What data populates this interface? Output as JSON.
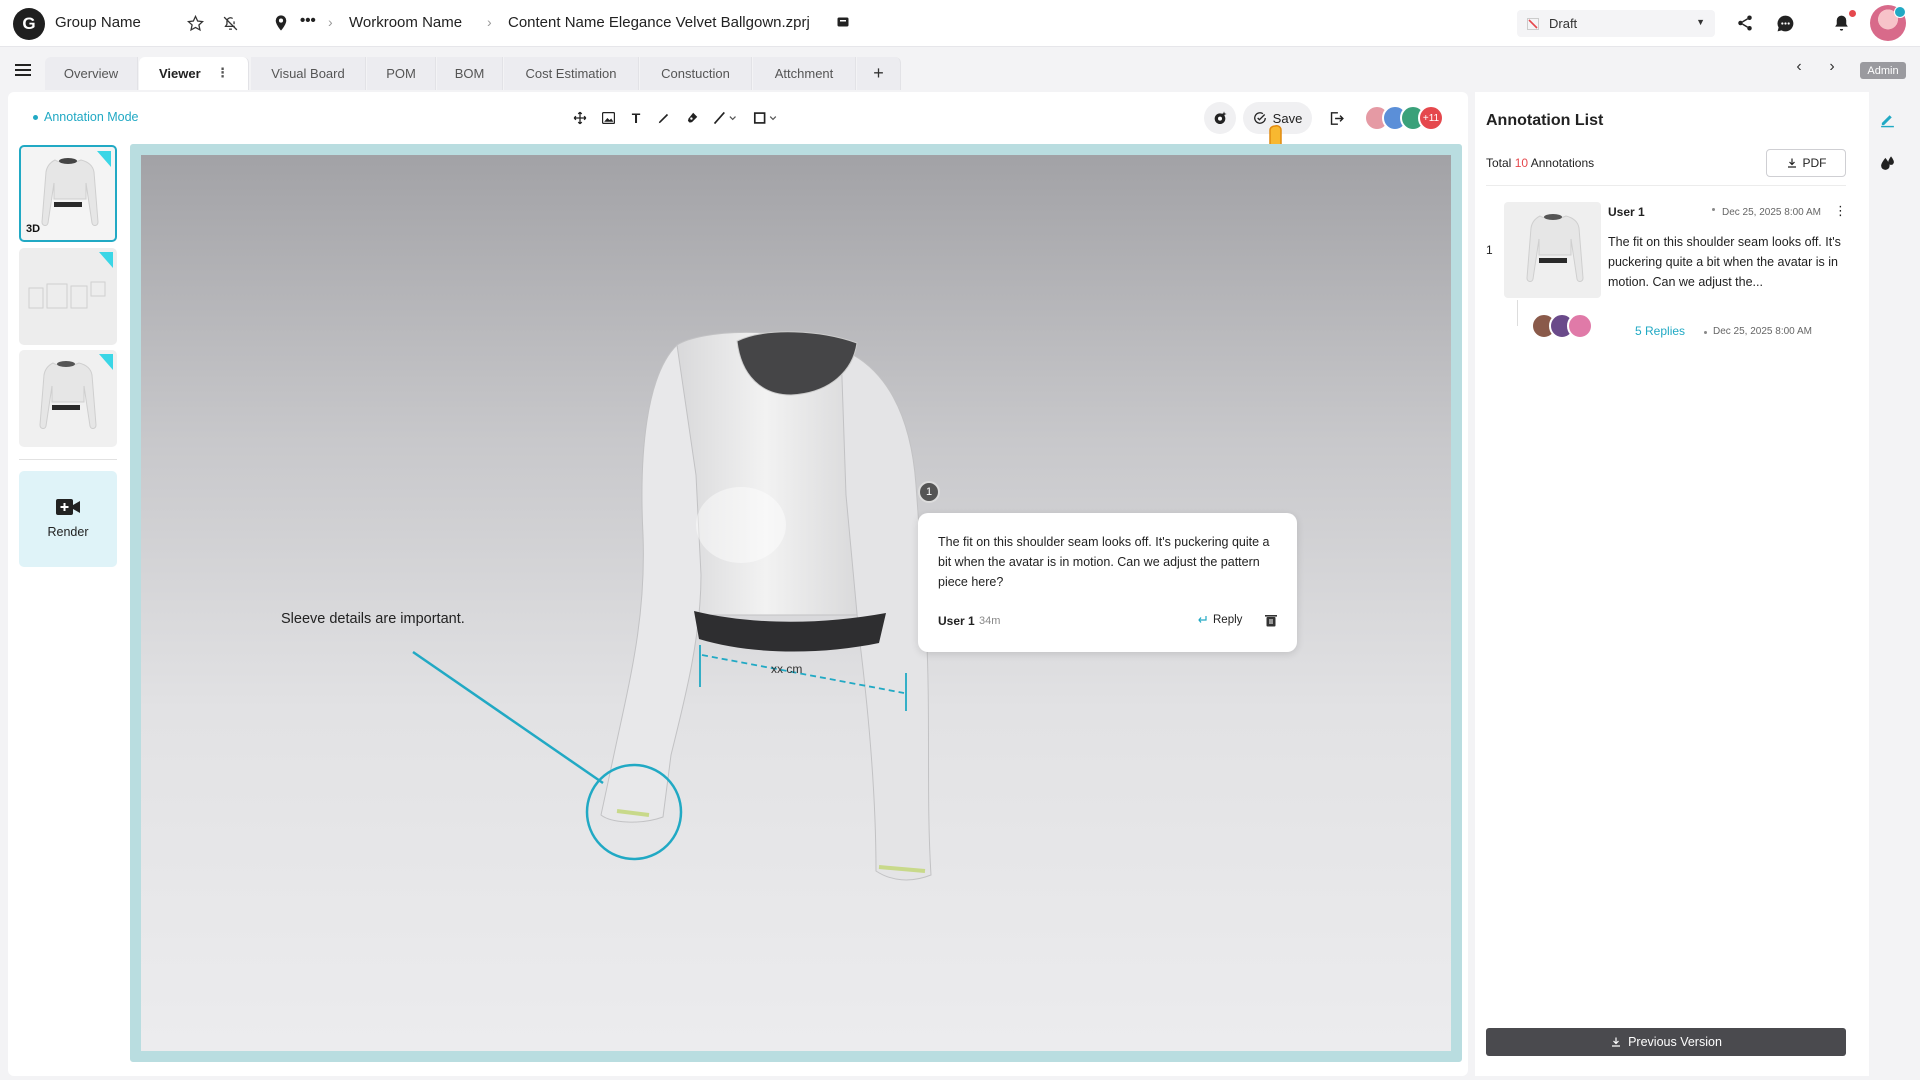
{
  "header": {
    "logo_letter": "G",
    "group_name": "Group Name",
    "breadcrumb_more": "•••",
    "workroom": "Workroom Name",
    "content_name": "Content Name Elegance Velvet Ballgown.zprj",
    "status": "Draft",
    "notification_dot_color": "#e5484d"
  },
  "tabs": [
    {
      "label": "Overview",
      "active": false
    },
    {
      "label": "Viewer",
      "active": true
    },
    {
      "label": "Visual Board",
      "active": false
    },
    {
      "label": "POM",
      "active": false
    },
    {
      "label": "BOM",
      "active": false
    },
    {
      "label": "Cost Estimation",
      "active": false
    },
    {
      "label": "Constuction",
      "active": false
    },
    {
      "label": "Attchment",
      "active": false
    }
  ],
  "user_role": "Admin",
  "toolbar": {
    "annotation_mode": "Annotation Mode",
    "save_label": "Save",
    "collaborators_extra": "+11",
    "tools": [
      "move-icon",
      "image-icon",
      "text-icon",
      "pen-icon",
      "marker-icon",
      "line-icon",
      "rectangle-icon"
    ]
  },
  "thumbnails": [
    {
      "label": "3D",
      "selected": true
    },
    {
      "label": "",
      "selected": false
    },
    {
      "label": "",
      "selected": false
    }
  ],
  "render_label": "Render",
  "viewer": {
    "sleeve_note": "Sleeve details are important.",
    "measurement_label": "xx cm",
    "marker_number": "1",
    "popup": {
      "text": "The fit on this shoulder seam looks off. It's puckering quite a bit when the avatar is in motion. Can we adjust the pattern piece here?",
      "user": "User 1",
      "time": "34m",
      "reply_label": "Reply"
    }
  },
  "annotation_list": {
    "title": "Annotation List",
    "total_prefix": "Total",
    "total_count": "10",
    "total_suffix": "Annotations",
    "pdf_label": "PDF",
    "items": [
      {
        "index": "1",
        "user": "User 1",
        "date": "Dec 25, 2025 8:00 AM",
        "text": "The fit on this shoulder seam looks off. It's puckering quite a bit when the avatar is in motion. Can we adjust the...",
        "replies": "5 Replies",
        "replies_date": "Dec 25, 2025 8:00 AM"
      }
    ],
    "previous_version_label": "Previous Version"
  },
  "colors": {
    "accent": "#21a9c4",
    "danger": "#e5484d",
    "frame": "#b9dde0",
    "dark_button": "#4a4a4e"
  }
}
